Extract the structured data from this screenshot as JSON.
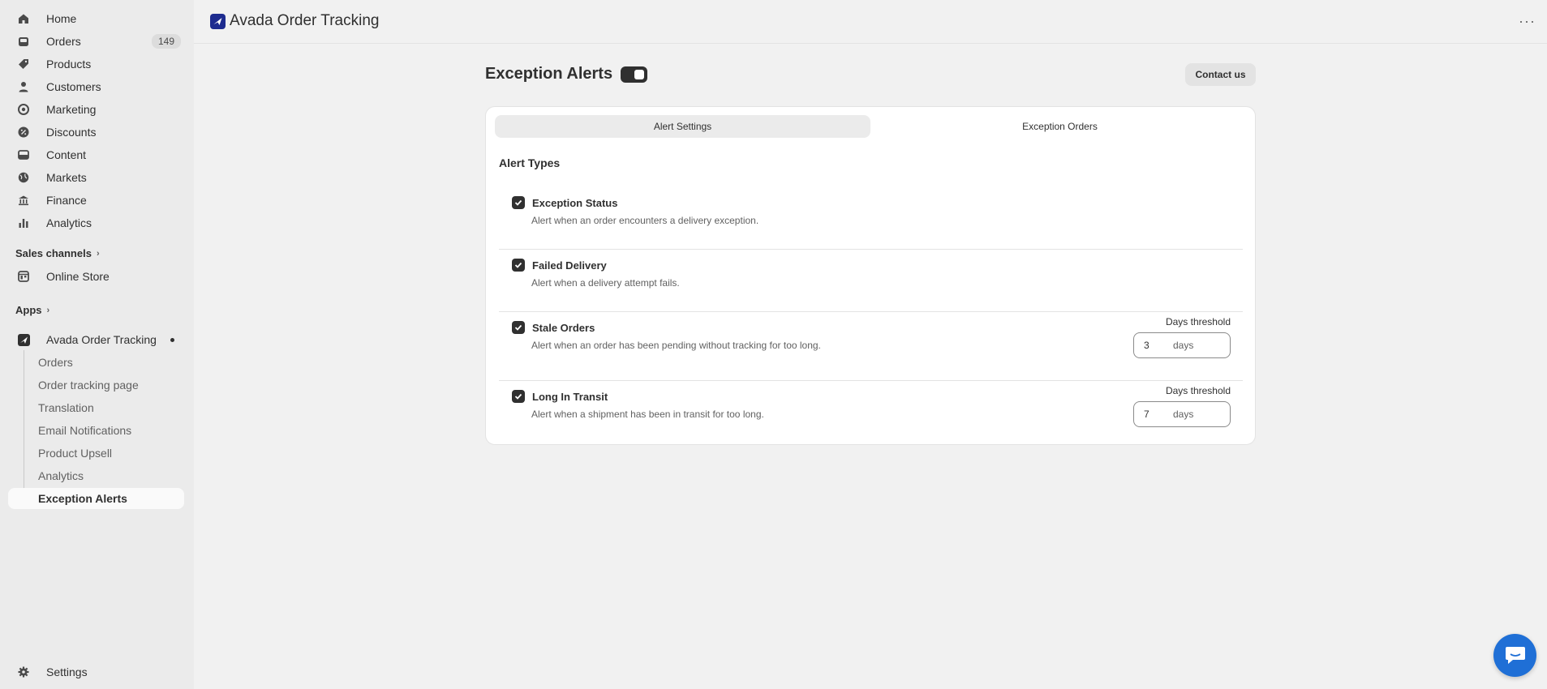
{
  "sidebar": {
    "items": [
      {
        "label": "Home",
        "icon": "home-icon"
      },
      {
        "label": "Orders",
        "icon": "orders-icon",
        "badge": "149"
      },
      {
        "label": "Products",
        "icon": "tag-icon"
      },
      {
        "label": "Customers",
        "icon": "person-icon"
      },
      {
        "label": "Marketing",
        "icon": "target-icon"
      },
      {
        "label": "Discounts",
        "icon": "discount-icon"
      },
      {
        "label": "Content",
        "icon": "content-icon"
      },
      {
        "label": "Markets",
        "icon": "globe-icon"
      },
      {
        "label": "Finance",
        "icon": "bank-icon"
      },
      {
        "label": "Analytics",
        "icon": "bar-chart-icon"
      }
    ],
    "sales_channels": {
      "label": "Sales channels",
      "items": [
        {
          "label": "Online Store",
          "icon": "store-icon"
        }
      ]
    },
    "apps": {
      "label": "Apps",
      "app": {
        "label": "Avada Order Tracking",
        "icon": "app-logo-icon"
      },
      "sub_items": [
        {
          "label": "Orders"
        },
        {
          "label": "Order tracking page"
        },
        {
          "label": "Translation"
        },
        {
          "label": "Email Notifications"
        },
        {
          "label": "Product Upsell"
        },
        {
          "label": "Analytics"
        },
        {
          "label": "Exception Alerts"
        }
      ]
    },
    "settings": {
      "label": "Settings",
      "icon": "gear-icon"
    }
  },
  "topbar": {
    "title": "Avada Order Tracking"
  },
  "page": {
    "title": "Exception Alerts",
    "toggle_on": true,
    "contact_label": "Contact us",
    "tabs": [
      {
        "label": "Alert Settings",
        "active": true
      },
      {
        "label": "Exception Orders",
        "active": false
      }
    ],
    "section_title": "Alert Types",
    "alerts": [
      {
        "name": "Exception Status",
        "desc": "Alert when an order encounters a delivery exception.",
        "checked": true
      },
      {
        "name": "Failed Delivery",
        "desc": "Alert when a delivery attempt fails.",
        "checked": true
      },
      {
        "name": "Stale Orders",
        "desc": "Alert when an order has been pending without tracking for too long.",
        "checked": true,
        "threshold_label": "Days threshold",
        "threshold_value": "3",
        "threshold_unit": "days"
      },
      {
        "name": "Long In Transit",
        "desc": "Alert when a shipment has been in transit for too long.",
        "checked": true,
        "threshold_label": "Days threshold",
        "threshold_value": "7",
        "threshold_unit": "days"
      }
    ]
  },
  "colors": {
    "accent": "#303030",
    "chat": "#1f6fd6",
    "app_logo": "#1d2b8f"
  }
}
